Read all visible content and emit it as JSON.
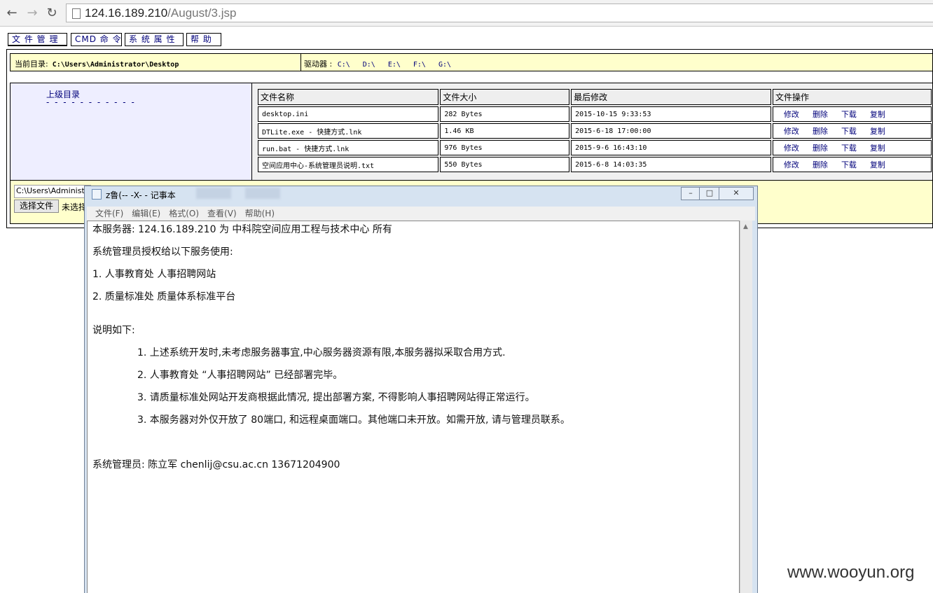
{
  "browser": {
    "url_host": "124.16.189.210",
    "url_path": "/August/3.jsp"
  },
  "nav_tabs": [
    "文 件 管 理",
    "CMD 命 令",
    "系 统 属 性",
    "帮 助"
  ],
  "current_dir": {
    "label": "当前目录:",
    "value": "C:\\Users\\Administrator\\Desktop"
  },
  "drives": {
    "label": "驱动器 :",
    "items": [
      "C:\\",
      "D:\\",
      "E:\\",
      "F:\\",
      "G:\\"
    ]
  },
  "left_pane": {
    "parent_link": "上级目录",
    "dashes": "- - - - - - - - - - -"
  },
  "file_table": {
    "headers": [
      "文件名称",
      "文件大小",
      "最后修改",
      "文件操作"
    ],
    "rows": [
      {
        "name": "desktop.ini",
        "size": "282 Bytes",
        "modified": "2015-10-15 9:33:53"
      },
      {
        "name": "DTLite.exe - 快捷方式.lnk",
        "size": "1.46 KB",
        "modified": "2015-6-18 17:00:00"
      },
      {
        "name": "run.bat - 快捷方式.lnk",
        "size": "976 Bytes",
        "modified": "2015-9-6 16:43:10"
      },
      {
        "name": "空间应用中心-系统管理员说明.txt",
        "size": "550 Bytes",
        "modified": "2015-6-8 14:03:35"
      }
    ],
    "ops": [
      "修改",
      "删除",
      "下载",
      "复制"
    ]
  },
  "upload": {
    "path_value": "C:\\Users\\Administ",
    "choose_label": "选择文件",
    "no_file": "未选择"
  },
  "notepad": {
    "title": "z鲁(--    -X- - 记事本",
    "menu": [
      "文件(F)",
      "编辑(E)",
      "格式(O)",
      "查看(V)",
      "帮助(H)"
    ],
    "lines": [
      "本服务器: 124.16.189.210 为  中科院空间应用工程与技术中心  所有",
      "系统管理员授权给以下服务使用:",
      "1.  人事教育处      人事招聘网站",
      "2.  质量标准处      质量体系标准平台",
      "说明如下:",
      "1.  上述系统开发时,未考虑服务器事宜,中心服务器资源有限,本服务器拟采取合用方式.",
      "2.  人事教育处 “人事招聘网站” 已经部署完毕。",
      "3.  请质量标准处网站开发商根据此情况,  提出部署方案,  不得影响人事招聘网站得正常运行。",
      "3.  本服务器对外仅开放了  80端口,  和远程桌面端口。其他端口未开放。如需开放,  请与管理员联系。",
      "系统管理员: 陈立军    chenlij@csu.ac.cn    13671204900"
    ]
  },
  "watermark": "www.wooyun.org"
}
